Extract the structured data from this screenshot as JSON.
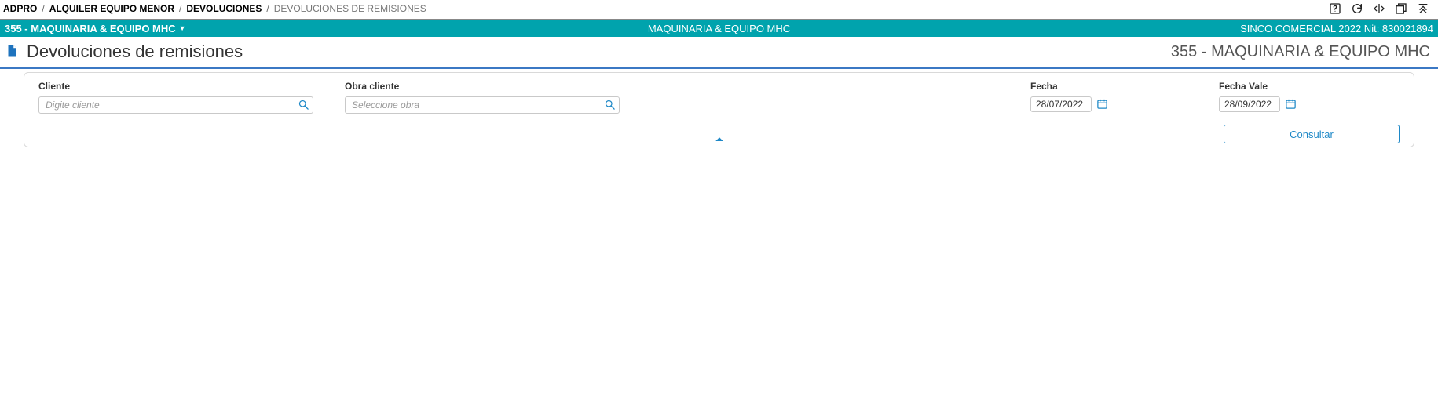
{
  "breadcrumbs": {
    "items": [
      "ADPRO",
      "ALQUILER EQUIPO MENOR",
      "DEVOLUCIONES"
    ],
    "current": "DEVOLUCIONES DE REMISIONES"
  },
  "context_bar": {
    "left": "355 - MAQUINARIA & EQUIPO MHC",
    "center": "MAQUINARIA & EQUIPO MHC",
    "right": "SINCO COMERCIAL 2022 Nit: 830021894"
  },
  "page": {
    "title": "Devoluciones de remisiones",
    "subtitle": "355 - MAQUINARIA & EQUIPO MHC"
  },
  "filters": {
    "cliente": {
      "label": "Cliente",
      "placeholder": "Digite cliente",
      "value": ""
    },
    "obra": {
      "label": "Obra cliente",
      "placeholder": "Seleccione obra",
      "value": ""
    },
    "fecha": {
      "label": "Fecha",
      "value": "28/07/2022"
    },
    "fecha_vale": {
      "label": "Fecha Vale",
      "value": "28/09/2022"
    }
  },
  "actions": {
    "consultar": "Consultar"
  },
  "colors": {
    "teal": "#00a3ad",
    "blue": "#1e88c7",
    "title_border": "#3b78c4"
  }
}
